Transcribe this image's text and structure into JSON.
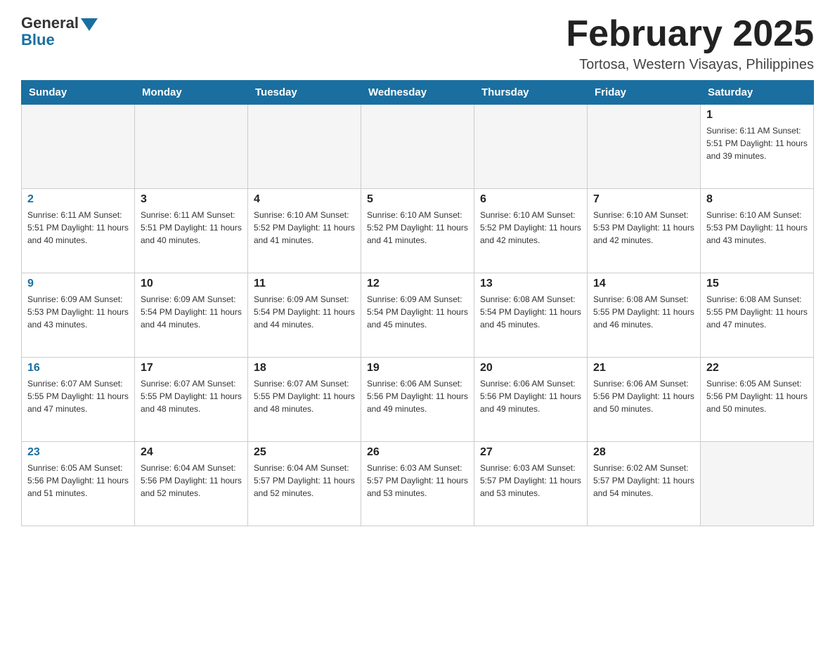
{
  "logo": {
    "general": "General",
    "blue": "Blue"
  },
  "title": "February 2025",
  "location": "Tortosa, Western Visayas, Philippines",
  "days_of_week": [
    "Sunday",
    "Monday",
    "Tuesday",
    "Wednesday",
    "Thursday",
    "Friday",
    "Saturday"
  ],
  "weeks": [
    [
      {
        "day": "",
        "info": ""
      },
      {
        "day": "",
        "info": ""
      },
      {
        "day": "",
        "info": ""
      },
      {
        "day": "",
        "info": ""
      },
      {
        "day": "",
        "info": ""
      },
      {
        "day": "",
        "info": ""
      },
      {
        "day": "1",
        "info": "Sunrise: 6:11 AM\nSunset: 5:51 PM\nDaylight: 11 hours\nand 39 minutes."
      }
    ],
    [
      {
        "day": "2",
        "info": "Sunrise: 6:11 AM\nSunset: 5:51 PM\nDaylight: 11 hours\nand 40 minutes."
      },
      {
        "day": "3",
        "info": "Sunrise: 6:11 AM\nSunset: 5:51 PM\nDaylight: 11 hours\nand 40 minutes."
      },
      {
        "day": "4",
        "info": "Sunrise: 6:10 AM\nSunset: 5:52 PM\nDaylight: 11 hours\nand 41 minutes."
      },
      {
        "day": "5",
        "info": "Sunrise: 6:10 AM\nSunset: 5:52 PM\nDaylight: 11 hours\nand 41 minutes."
      },
      {
        "day": "6",
        "info": "Sunrise: 6:10 AM\nSunset: 5:52 PM\nDaylight: 11 hours\nand 42 minutes."
      },
      {
        "day": "7",
        "info": "Sunrise: 6:10 AM\nSunset: 5:53 PM\nDaylight: 11 hours\nand 42 minutes."
      },
      {
        "day": "8",
        "info": "Sunrise: 6:10 AM\nSunset: 5:53 PM\nDaylight: 11 hours\nand 43 minutes."
      }
    ],
    [
      {
        "day": "9",
        "info": "Sunrise: 6:09 AM\nSunset: 5:53 PM\nDaylight: 11 hours\nand 43 minutes."
      },
      {
        "day": "10",
        "info": "Sunrise: 6:09 AM\nSunset: 5:54 PM\nDaylight: 11 hours\nand 44 minutes."
      },
      {
        "day": "11",
        "info": "Sunrise: 6:09 AM\nSunset: 5:54 PM\nDaylight: 11 hours\nand 44 minutes."
      },
      {
        "day": "12",
        "info": "Sunrise: 6:09 AM\nSunset: 5:54 PM\nDaylight: 11 hours\nand 45 minutes."
      },
      {
        "day": "13",
        "info": "Sunrise: 6:08 AM\nSunset: 5:54 PM\nDaylight: 11 hours\nand 45 minutes."
      },
      {
        "day": "14",
        "info": "Sunrise: 6:08 AM\nSunset: 5:55 PM\nDaylight: 11 hours\nand 46 minutes."
      },
      {
        "day": "15",
        "info": "Sunrise: 6:08 AM\nSunset: 5:55 PM\nDaylight: 11 hours\nand 47 minutes."
      }
    ],
    [
      {
        "day": "16",
        "info": "Sunrise: 6:07 AM\nSunset: 5:55 PM\nDaylight: 11 hours\nand 47 minutes."
      },
      {
        "day": "17",
        "info": "Sunrise: 6:07 AM\nSunset: 5:55 PM\nDaylight: 11 hours\nand 48 minutes."
      },
      {
        "day": "18",
        "info": "Sunrise: 6:07 AM\nSunset: 5:55 PM\nDaylight: 11 hours\nand 48 minutes."
      },
      {
        "day": "19",
        "info": "Sunrise: 6:06 AM\nSunset: 5:56 PM\nDaylight: 11 hours\nand 49 minutes."
      },
      {
        "day": "20",
        "info": "Sunrise: 6:06 AM\nSunset: 5:56 PM\nDaylight: 11 hours\nand 49 minutes."
      },
      {
        "day": "21",
        "info": "Sunrise: 6:06 AM\nSunset: 5:56 PM\nDaylight: 11 hours\nand 50 minutes."
      },
      {
        "day": "22",
        "info": "Sunrise: 6:05 AM\nSunset: 5:56 PM\nDaylight: 11 hours\nand 50 minutes."
      }
    ],
    [
      {
        "day": "23",
        "info": "Sunrise: 6:05 AM\nSunset: 5:56 PM\nDaylight: 11 hours\nand 51 minutes."
      },
      {
        "day": "24",
        "info": "Sunrise: 6:04 AM\nSunset: 5:56 PM\nDaylight: 11 hours\nand 52 minutes."
      },
      {
        "day": "25",
        "info": "Sunrise: 6:04 AM\nSunset: 5:57 PM\nDaylight: 11 hours\nand 52 minutes."
      },
      {
        "day": "26",
        "info": "Sunrise: 6:03 AM\nSunset: 5:57 PM\nDaylight: 11 hours\nand 53 minutes."
      },
      {
        "day": "27",
        "info": "Sunrise: 6:03 AM\nSunset: 5:57 PM\nDaylight: 11 hours\nand 53 minutes."
      },
      {
        "day": "28",
        "info": "Sunrise: 6:02 AM\nSunset: 5:57 PM\nDaylight: 11 hours\nand 54 minutes."
      },
      {
        "day": "",
        "info": ""
      }
    ]
  ]
}
